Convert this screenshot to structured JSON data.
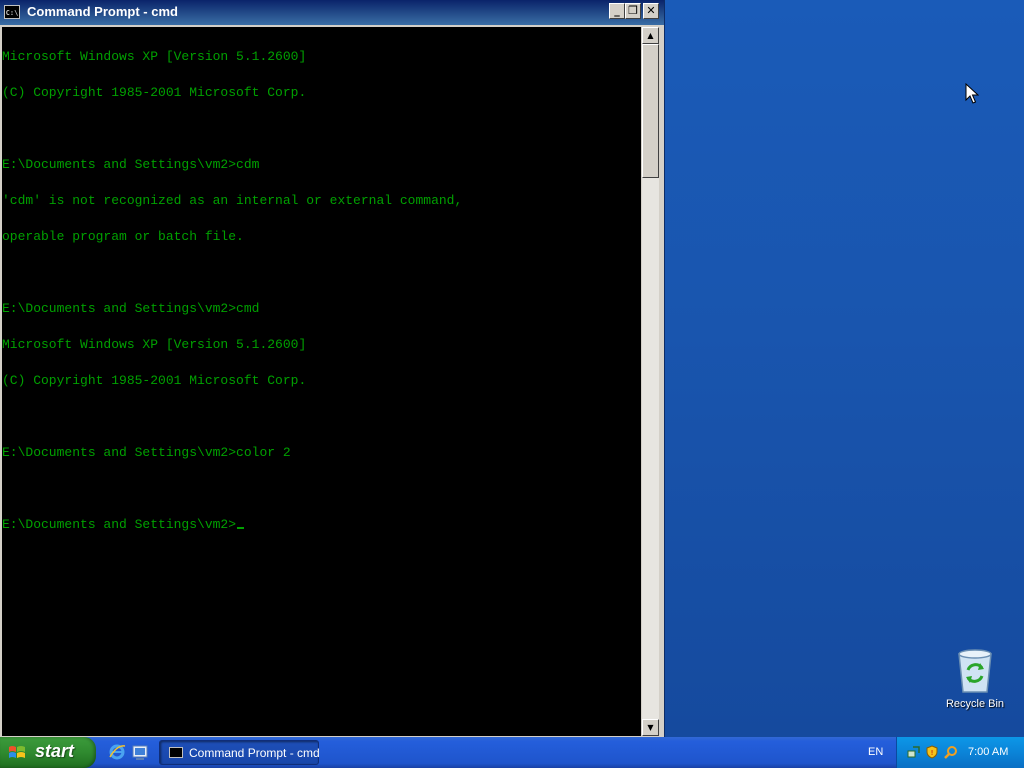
{
  "window": {
    "title": "Command Prompt - cmd",
    "system_icon_text": "C:\\",
    "buttons": {
      "minimize": "_",
      "maximize": "❐",
      "close": "✕"
    }
  },
  "console": {
    "text_color": "#00a000",
    "background": "#000000",
    "lines": [
      "Microsoft Windows XP [Version 5.1.2600]",
      "(C) Copyright 1985-2001 Microsoft Corp.",
      "",
      "E:\\Documents and Settings\\vm2>cdm",
      "'cdm' is not recognized as an internal or external command,",
      "operable program or batch file.",
      "",
      "E:\\Documents and Settings\\vm2>cmd",
      "Microsoft Windows XP [Version 5.1.2600]",
      "(C) Copyright 1985-2001 Microsoft Corp.",
      "",
      "E:\\Documents and Settings\\vm2>color 2",
      "",
      "E:\\Documents and Settings\\vm2>"
    ]
  },
  "scrollbar": {
    "up": "▲",
    "down": "▼"
  },
  "desktop": {
    "icons": [
      {
        "label": "Recycle Bin",
        "icon": "recycle-bin-icon"
      }
    ]
  },
  "taskbar": {
    "start_label": "start",
    "quick_launch": [
      "internet-explorer-icon",
      "show-desktop-icon"
    ],
    "tasks": [
      {
        "label": "Command Prompt - cmd",
        "icon": "cmd-icon"
      }
    ],
    "language": "EN",
    "tray_icons": [
      "network-icon",
      "security-shield-icon",
      "search-icon"
    ],
    "clock": "7:00 AM"
  }
}
